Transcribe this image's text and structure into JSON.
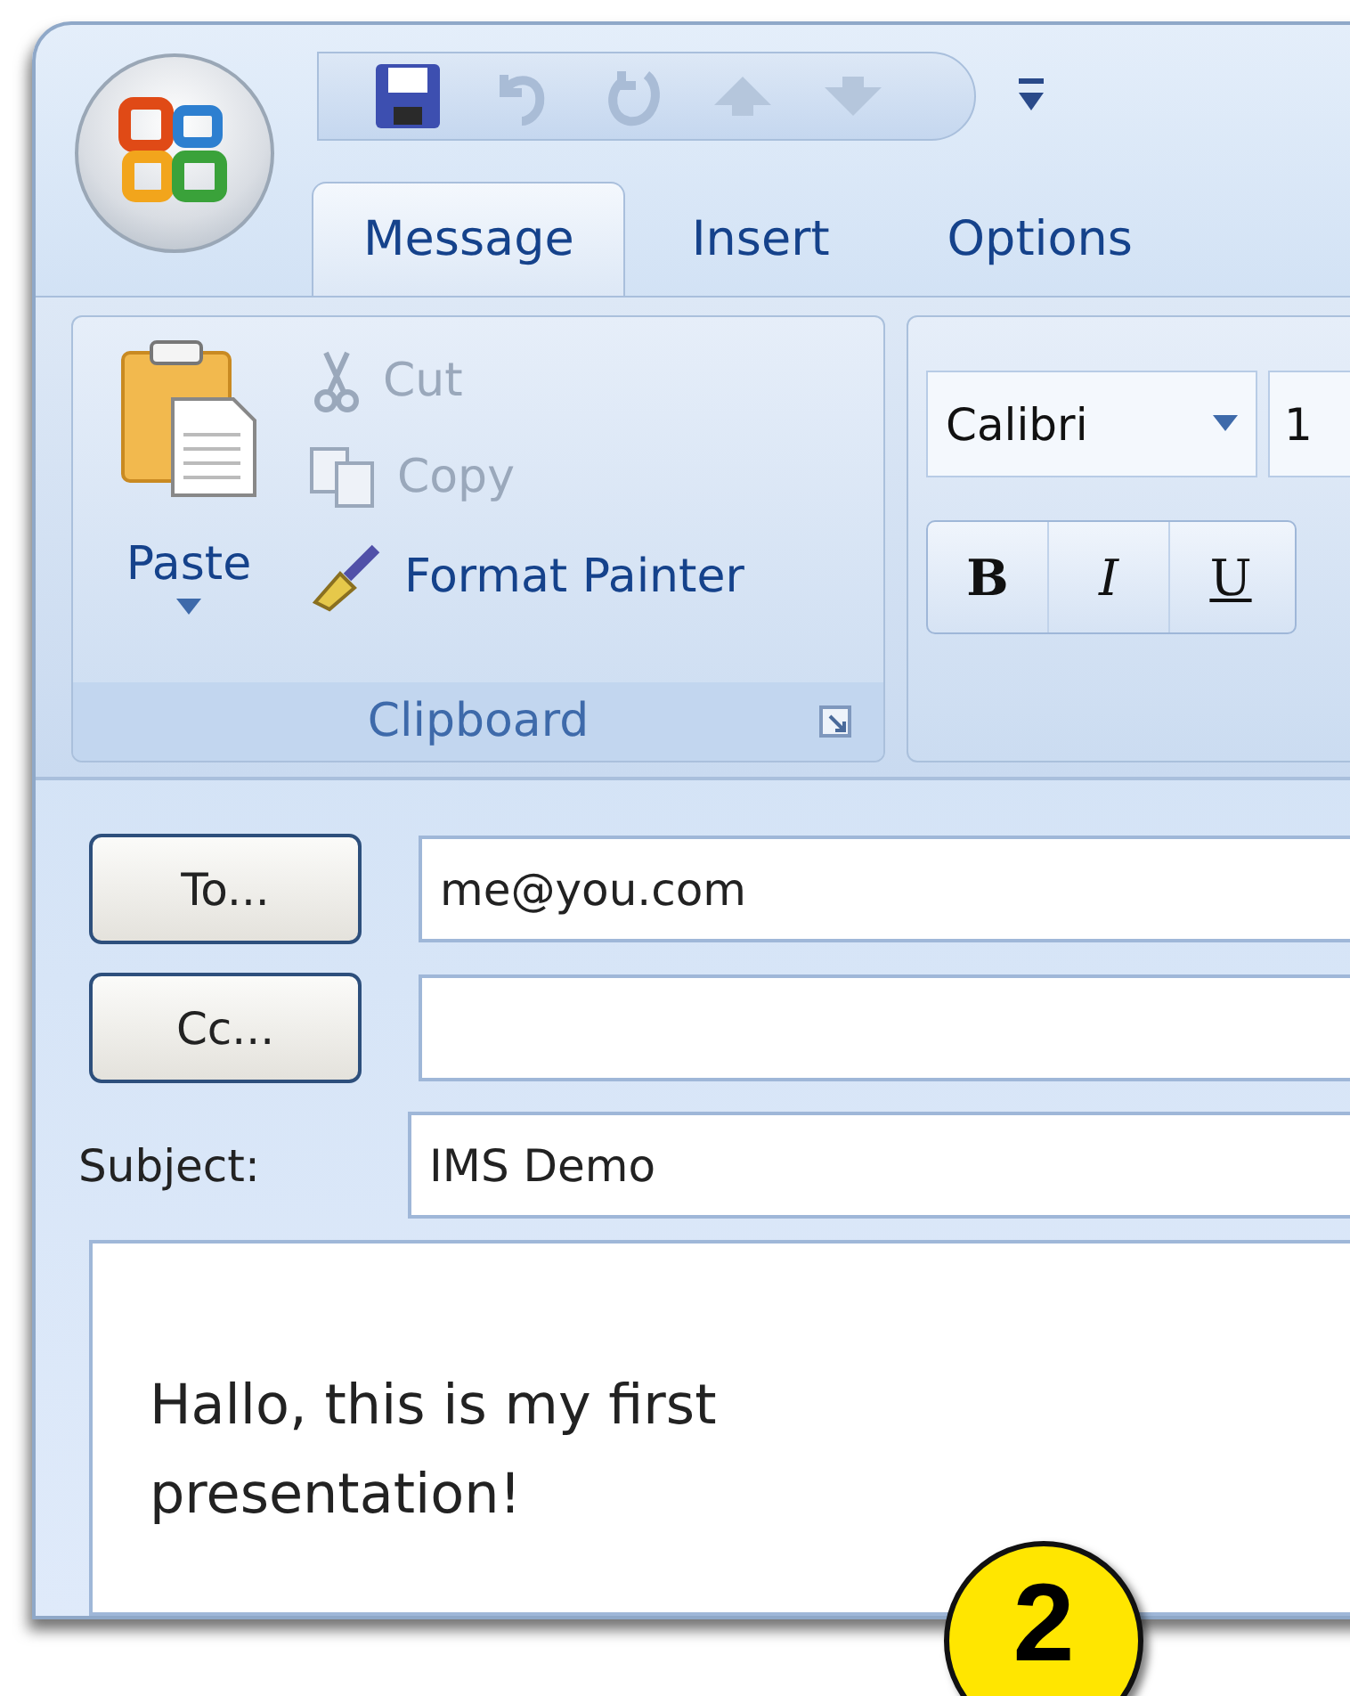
{
  "tabs": [
    {
      "label": "Message",
      "selected": true
    },
    {
      "label": "Insert",
      "selected": false
    },
    {
      "label": "Options",
      "selected": false
    }
  ],
  "clipboard_group": {
    "title": "Clipboard",
    "paste": "Paste",
    "commands": [
      {
        "kind": "cut",
        "label": "Cut",
        "disabled": true
      },
      {
        "kind": "copy",
        "label": "Copy",
        "disabled": true
      },
      {
        "kind": "format-painter",
        "label": "Format Painter",
        "disabled": false
      }
    ]
  },
  "font_group": {
    "font_name": "Calibri",
    "font_size": "1",
    "format_buttons": [
      {
        "kind": "bold",
        "label": "B"
      },
      {
        "kind": "italic",
        "label": "I"
      },
      {
        "kind": "underline",
        "label": "U"
      }
    ]
  },
  "address_fields": [
    {
      "button": "To...",
      "value": "me@you.com"
    },
    {
      "button": "Cc..."
    }
  ],
  "subject": {
    "label": "Subject:",
    "value": "IMS Demo"
  },
  "body": {
    "lines": [
      "Hallo, this is my first",
      "presentation!"
    ]
  },
  "callout_badge": "2"
}
